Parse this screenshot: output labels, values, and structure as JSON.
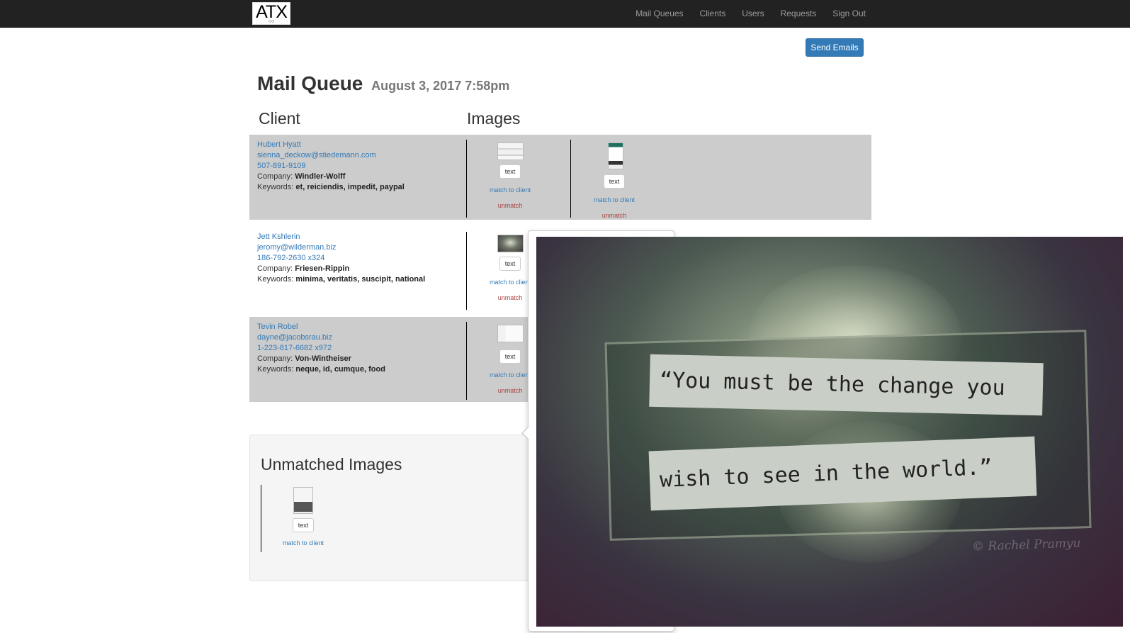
{
  "navbar": {
    "logo": "ATX",
    "links": [
      "Mail Queues",
      "Clients",
      "Users",
      "Requests",
      "Sign Out"
    ]
  },
  "send_button": "Send Emails",
  "page": {
    "title": "Mail Queue",
    "date": "August 3, 2017 7:58pm"
  },
  "columns": {
    "client": "Client",
    "images": "Images"
  },
  "labels": {
    "company": "Company:",
    "keywords": "Keywords:",
    "text_button": "text",
    "match": "match to client",
    "unmatch": "unmatch"
  },
  "clients": [
    {
      "name": "Hubert Hyatt",
      "email": "sienna_deckow@stiedemann.com",
      "phone": "507-891-9109",
      "company": "Windler-Wolff",
      "keywords": "et, reiciendis, impedit, paypal"
    },
    {
      "name": "Jett Kshlerin",
      "email": "jeromy@wilderman.biz",
      "phone": "186-792-2630 x324",
      "company": "Friesen-Rippin",
      "keywords": "minima, veritatis, suscipit, national"
    },
    {
      "name": "Tevin Robel",
      "email": "dayne@jacobsrau.biz",
      "phone": "1-223-817-6682 x972",
      "company": "Von-Wintheiser",
      "keywords": "neque, id, cumque, food"
    }
  ],
  "unmatched": {
    "title": "Unmatched Images"
  },
  "preview": {
    "line1": "“You must be the change you",
    "line2": "wish to see in the world.”",
    "credit": "© Rachel Pramyu"
  }
}
